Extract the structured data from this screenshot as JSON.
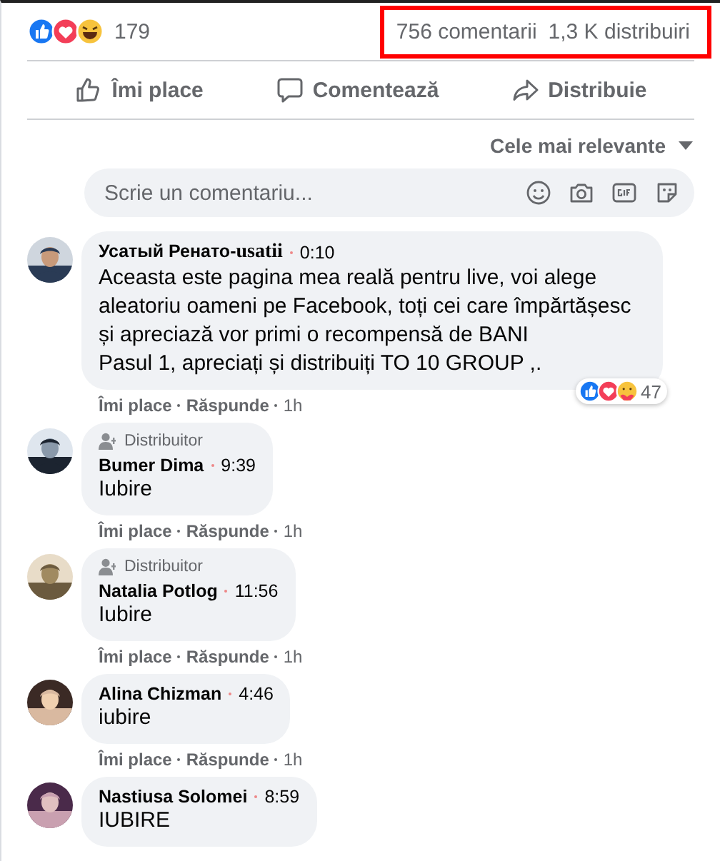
{
  "stats": {
    "reaction_count": "179",
    "comments": "756 comentarii",
    "shares": "1,3 K distribuiri",
    "highlighted": true
  },
  "actions": [
    {
      "kind": "like",
      "label": "Îmi place"
    },
    {
      "kind": "comment",
      "label": "Comentează"
    },
    {
      "kind": "share",
      "label": "Distribuie"
    }
  ],
  "sort": {
    "label": "Cele mai relevante"
  },
  "comment_field": {
    "placeholder": "Scrie un comentariu..."
  },
  "comments": [
    {
      "author": "Усатый Ренато-**usatii**",
      "time": "0:10",
      "text": "Aceasta este pagina mea reală pentru live, voi alege aleatoriu oameni pe Facebook, toți cei care împărtășesc și apreciază vor primi o recompensă de BANI\nPasul 1, apreciați și distribuiți TO 10 GROUP ,.",
      "reaction_count": "47",
      "like": "Îmi place",
      "reply": "Răspunde",
      "age": "1h"
    },
    {
      "author": "Bumer Dima",
      "badge": "Distribuitor",
      "time": "9:39",
      "text": "Iubire",
      "like": "Îmi place",
      "reply": "Răspunde",
      "age": "1h"
    },
    {
      "author": "Natalia Potlog",
      "badge": "Distribuitor",
      "time": "11:56",
      "text": "Iubire",
      "like": "Îmi place",
      "reply": "Răspunde",
      "age": "1h"
    },
    {
      "author": "Alina Chizman",
      "time": "4:46",
      "text": "iubire",
      "like": "Îmi place",
      "reply": "Răspunde",
      "age": "1h"
    },
    {
      "author": "Nastiusa Solomei",
      "time": "8:59",
      "text": "IUBIRE"
    }
  ]
}
